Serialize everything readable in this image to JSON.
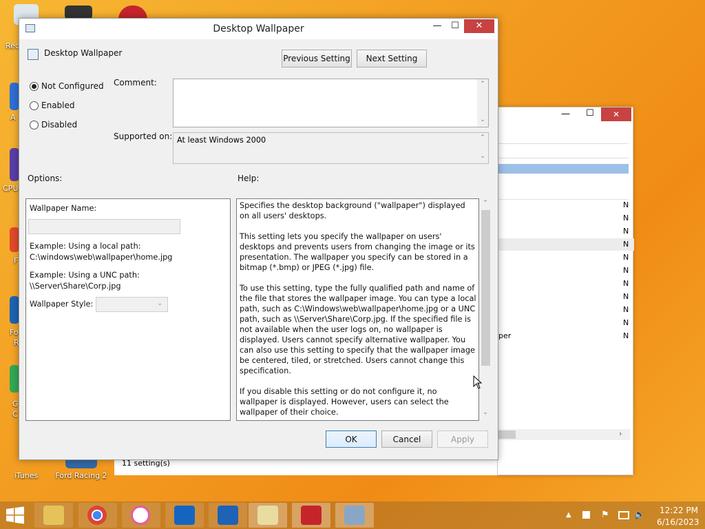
{
  "desktop": {
    "icons": [
      {
        "label": "iTunes",
        "color": "#e85aa8"
      },
      {
        "label": "Ford Racing 2",
        "color": "#1e63b5"
      }
    ],
    "edge_labels": [
      "Rec",
      "A",
      "CPU",
      "F",
      "Fo",
      "R",
      "G",
      "C"
    ]
  },
  "dialog": {
    "title": "Desktop Wallpaper",
    "window_buttons": {
      "minimize": "—",
      "maximize": "☐",
      "close": "✕"
    },
    "policy_name": "Desktop Wallpaper",
    "previous_setting": "Previous Setting",
    "next_setting": "Next Setting",
    "radios": [
      {
        "label": "Not Configured",
        "checked": true
      },
      {
        "label": "Enabled",
        "checked": false
      },
      {
        "label": "Disabled",
        "checked": false
      }
    ],
    "comment_label": "Comment:",
    "comment_value": "",
    "supported_label": "Supported on:",
    "supported_value": "At least Windows 2000",
    "options_label": "Options:",
    "help_label": "Help:",
    "options": {
      "wallpaper_name_label": "Wallpaper Name:",
      "wallpaper_name_value": "",
      "local_example_line1": "Example: Using a local path:",
      "local_example_line2": "C:\\windows\\web\\wallpaper\\home.jpg",
      "unc_example_line1": "Example: Using a UNC path:",
      "unc_example_line2": "\\\\Server\\Share\\Corp.jpg",
      "wallpaper_style_label": "Wallpaper Style:",
      "wallpaper_style_value": ""
    },
    "help": {
      "p1": "Specifies the desktop background (\"wallpaper\") displayed on all users' desktops.",
      "p2": "This setting lets you specify the wallpaper on users' desktops and prevents users from changing the image or its presentation. The wallpaper you specify can be stored in a bitmap (*.bmp) or JPEG (*.jpg) file.",
      "p3": "To use this setting, type the fully qualified path and name of the file that stores the wallpaper image. You can type a local path, such as C:\\Windows\\web\\wallpaper\\home.jpg or a UNC path, such as \\\\Server\\Share\\Corp.jpg. If the specified file is not available when the user logs on, no wallpaper is displayed. Users cannot specify alternative wallpaper. You can also use this setting to specify that the wallpaper image be centered, tiled, or stretched. Users cannot change this specification.",
      "p4": "If you disable this setting or do not configure it, no wallpaper is displayed. However, users can select the wallpaper of their choice."
    },
    "ok": "OK",
    "cancel": "Cancel",
    "apply": "Apply"
  },
  "background_window": {
    "status": "11 setting(s)",
    "row_marks": [
      "N",
      "N",
      "N",
      "N",
      "N",
      "N",
      "N",
      "N",
      "N",
      "N",
      "N"
    ],
    "partial_text": "per"
  },
  "taskbar": {
    "start_icon": "windows-logo",
    "apps": [
      {
        "name": "file-explorer-icon",
        "color": "#e5c35a"
      },
      {
        "name": "chrome-icon",
        "color": "#4285f4"
      },
      {
        "name": "itunes-icon",
        "color": "#e85aa8"
      },
      {
        "name": "fileline-icon",
        "color": "#1565c0"
      },
      {
        "name": "ford-racing-icon",
        "color": "#1e63b5"
      },
      {
        "name": "notepad-icon",
        "color": "#e8dca0"
      },
      {
        "name": "game-icon",
        "color": "#c6242b"
      },
      {
        "name": "monitor-icon",
        "color": "#8aa6c5"
      }
    ],
    "time": "12:22 PM",
    "date": "6/16/2023"
  }
}
